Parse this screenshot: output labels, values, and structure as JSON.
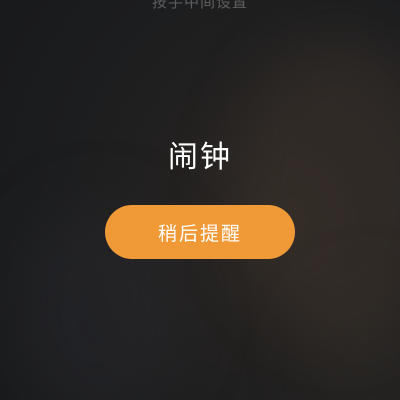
{
  "hint": {
    "text": "按手中间设置"
  },
  "alarm": {
    "title": "闹钟",
    "snooze_label": "稍后提醒"
  },
  "colors": {
    "accent": "#f09a37",
    "background": "#1c1d1f",
    "text": "#ffffff"
  }
}
